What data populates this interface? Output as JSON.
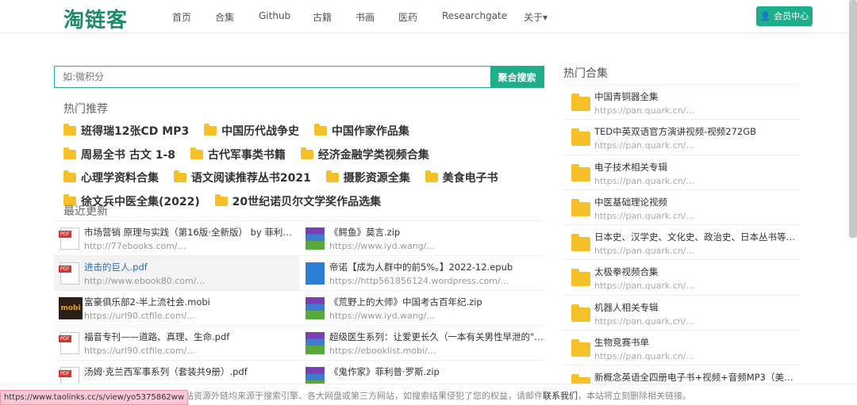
{
  "nav": {
    "logo": "淘链客",
    "items": [
      "首页",
      "合集",
      "Github",
      "古籍",
      "书画",
      "医药",
      "Researchgate",
      "关于▾"
    ],
    "member": "会员中心"
  },
  "search": {
    "placeholder": "如:微积分",
    "button": "聚合搜索"
  },
  "hot": {
    "title": "热门推荐",
    "tags": [
      "班得瑞12张CD MP3",
      "中国历代战争史",
      "中国作家作品集",
      "周易全书 古文 1-8",
      "古代军事类书籍",
      "经济金融学类视频合集",
      "心理学资料合集",
      "语文阅读推荐丛书2021",
      "摄影资源全集",
      "美食电子书",
      "徐文兵中医全集(2022)",
      "20世纪诺贝尔文学奖作品选集"
    ]
  },
  "recent": {
    "title": "最近更新",
    "items": [
      {
        "type": "pdf",
        "title": "市场营销 原理与实践（第16版·全新版） by 菲利普·...",
        "url": "http://77ebooks.com/..."
      },
      {
        "type": "zip",
        "title": "《鳄鱼》莫言.zip",
        "url": "https://www.iyd.wang/..."
      },
      {
        "type": "pdf",
        "title": "进击的巨人.pdf",
        "url": "http://www.ebook80.com/...",
        "hl": true
      },
      {
        "type": "epub",
        "title": "帝诺【成为人群中的前5%。】2022-12.epub",
        "url": "https://http561856124.wordpress.com/..."
      },
      {
        "type": "mobi",
        "title": "富豪俱乐部2-半上流社会.mobi",
        "url": "https://url90.ctfile.com/..."
      },
      {
        "type": "zip",
        "title": "《荒野上的大师》中国考古百年纪.zip",
        "url": "https://www.iyd.wang/..."
      },
      {
        "type": "pdf",
        "title": "福音专刊——道路、真理、生命.pdf",
        "url": "https://url90.ctfile.com/..."
      },
      {
        "type": "zip",
        "title": "超级医生系列：让爱更长久（一本有关男性早泄的\"百...",
        "url": "https://ebooklist.mobi/..."
      },
      {
        "type": "pdf",
        "title": "汤姆·克兰西军事系列（套装共9册）.pdf",
        "url": ""
      },
      {
        "type": "zip",
        "title": "《鬼作家》菲利普·罗斯.zip",
        "url": ""
      }
    ]
  },
  "side": {
    "title": "热门合集",
    "items": [
      {
        "title": "中国青铜器全集",
        "url": "https://pan.quark.cn/..."
      },
      {
        "title": "TED中英双语官方演讲视频-视频272GB",
        "url": "https://pan.quark.cn/..."
      },
      {
        "title": "电子技术相关专辑",
        "url": "https://pan.quark.cn/..."
      },
      {
        "title": "中医基础理论视频",
        "url": "https://pan.quark.cn/..."
      },
      {
        "title": "日本史、汉学史、文化史、政治史、日本丛书等合集",
        "url": "https://pan.quark.cn/..."
      },
      {
        "title": "太极拳视频合集",
        "url": "https://pan.quark.cn/..."
      },
      {
        "title": "机器人相关专辑",
        "url": "https://pan.quark.cn/..."
      },
      {
        "title": "生物竞赛书单",
        "url": "https://pan.quark.cn/..."
      },
      {
        "title": "新概念英语全四册电子书+视频+音频MP3（美音+...",
        "url": ""
      }
    ]
  },
  "footer": {
    "text1": "本站资源外链均来源于搜索引擎、各大网盘或第三方网站，如搜索结果侵犯了您的权益，请邮件",
    "link": "联系我们",
    "text2": "，本站将立刻删除相关链接。"
  },
  "status_url": "https://www.taolinks.cc/s/view/yo5375862ww"
}
